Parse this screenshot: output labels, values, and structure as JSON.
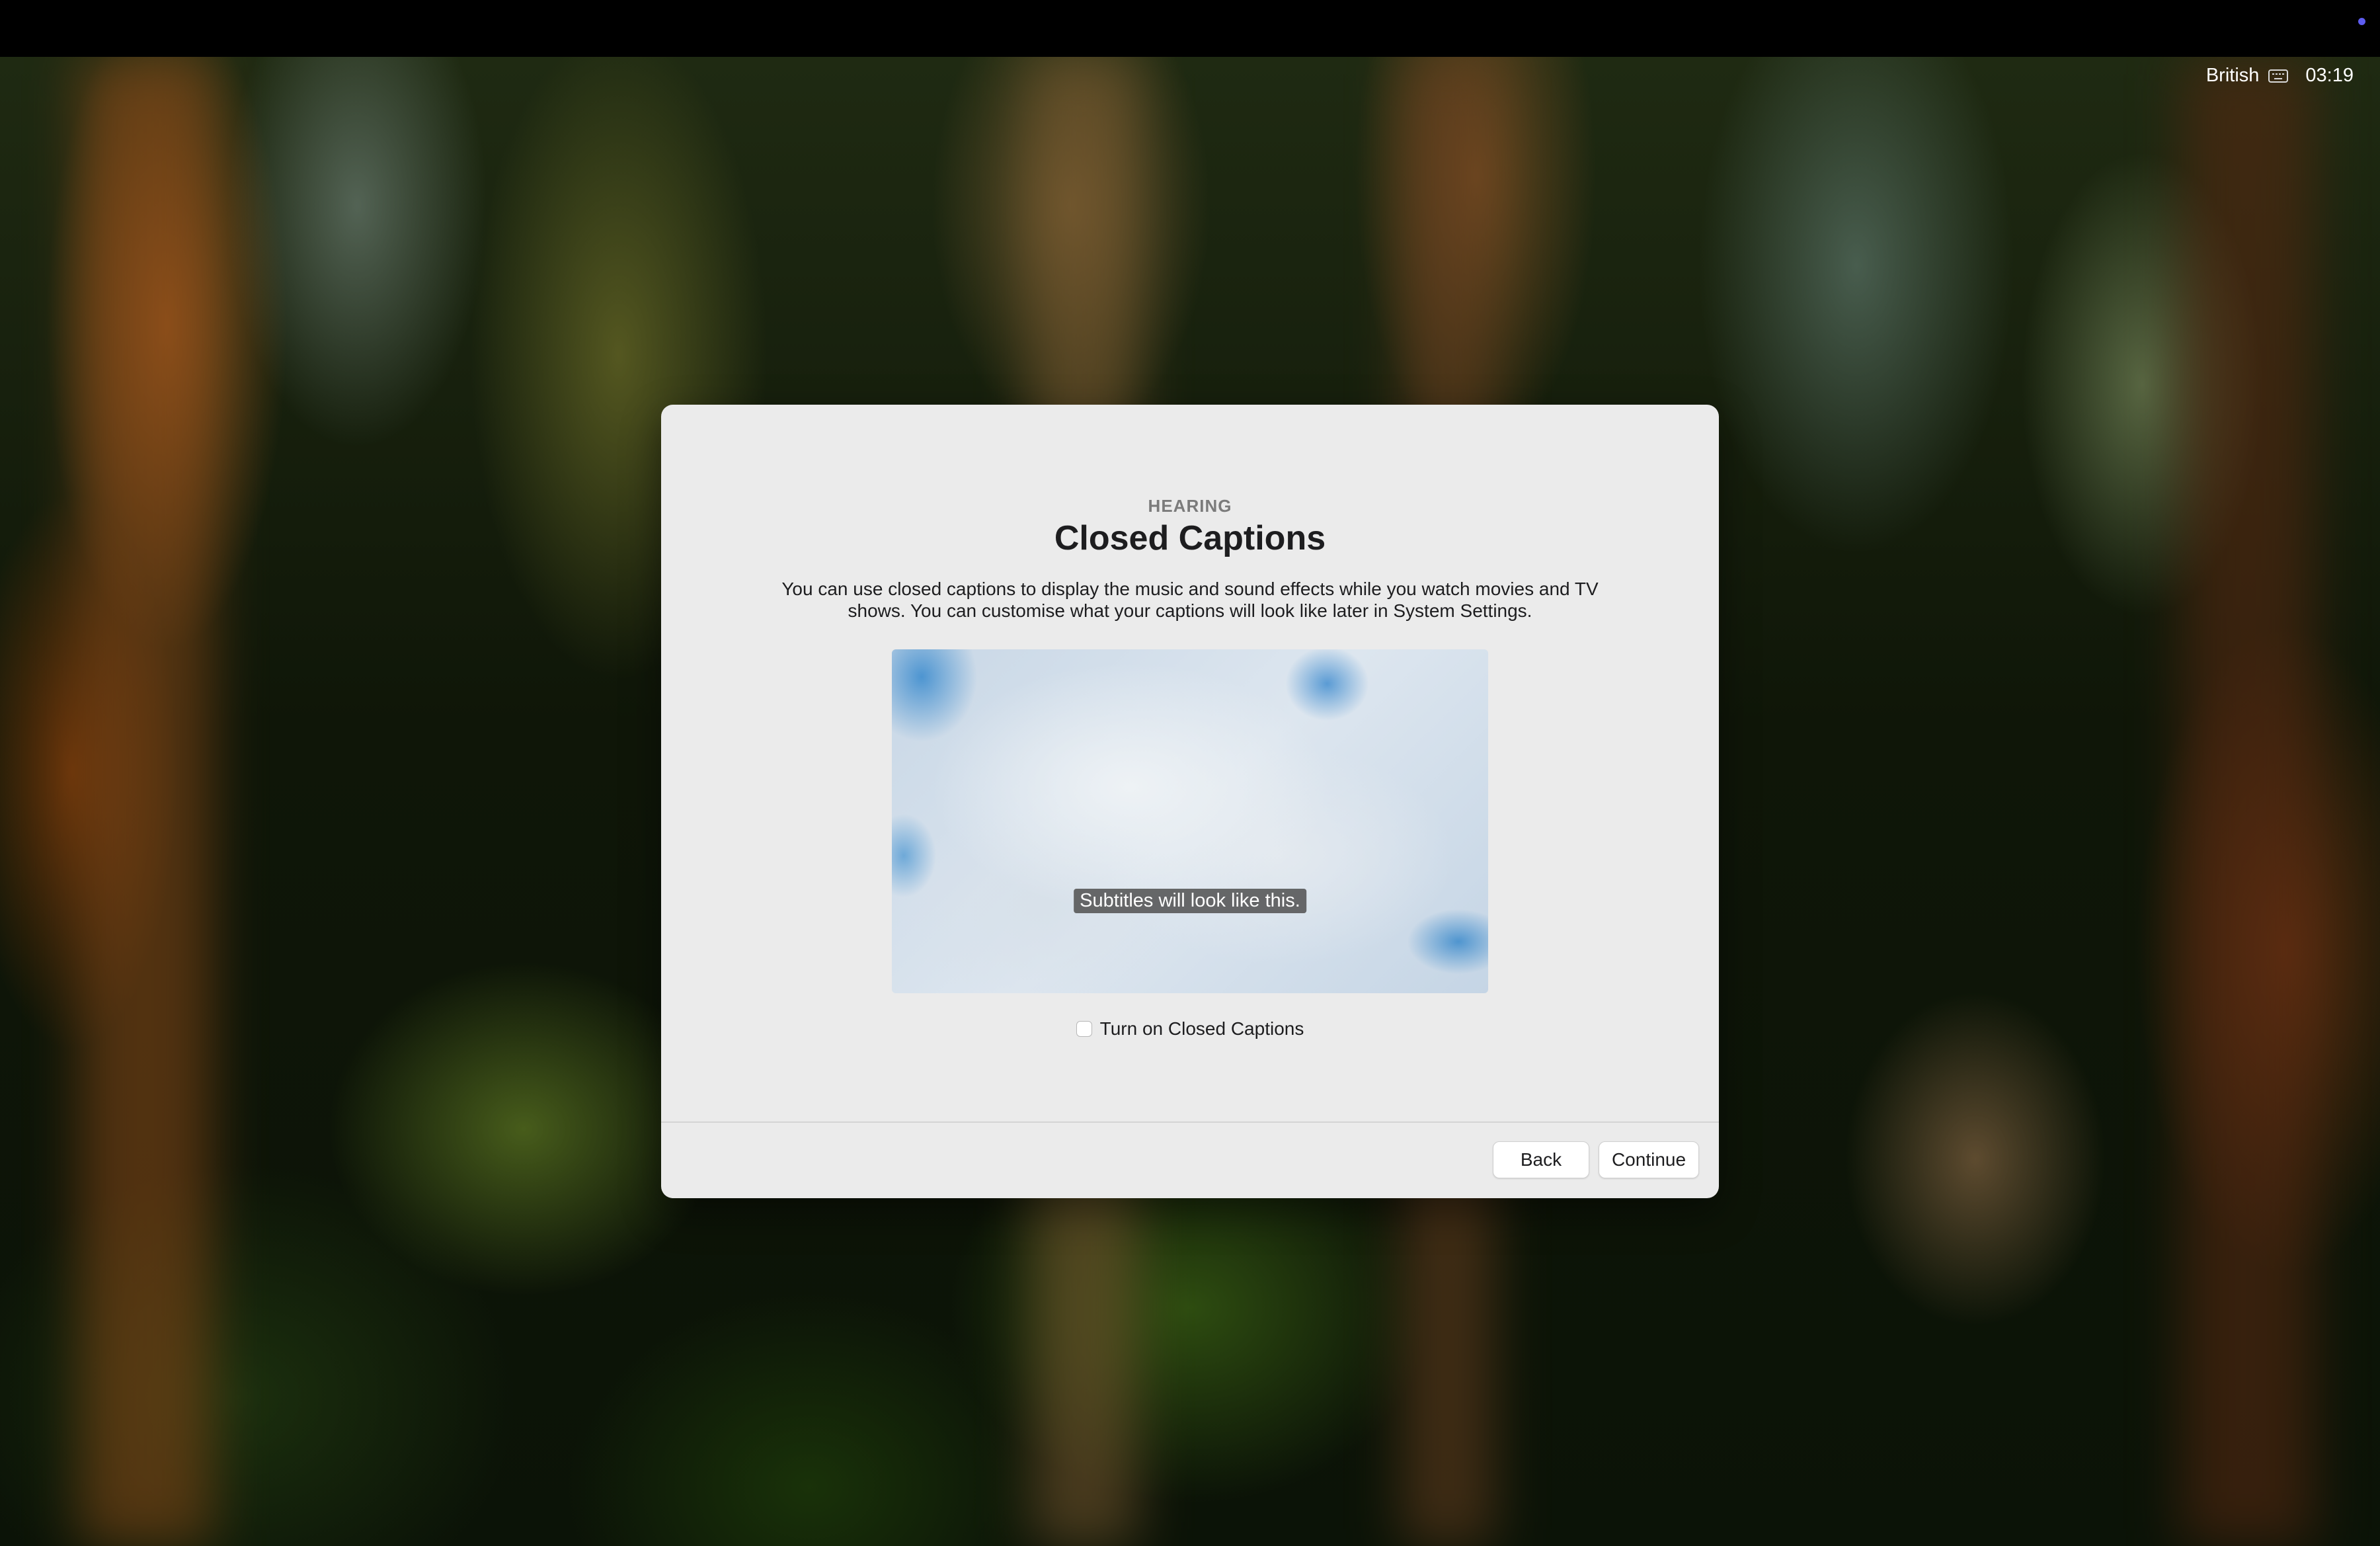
{
  "status_bar": {
    "input_source": "British",
    "input_source_icon": "keyboard-icon",
    "time": "03:19"
  },
  "dialog": {
    "section": "HEARING",
    "title": "Closed Captions",
    "description": "You can use closed captions to display the music and sound effects while you watch movies and TV shows. You can customise what your captions will look like later in System Settings.",
    "preview": {
      "subtitle_sample": "Subtitles will look like this."
    },
    "checkbox": {
      "label": "Turn on Closed Captions",
      "checked": false
    },
    "buttons": {
      "back": "Back",
      "continue": "Continue"
    }
  },
  "colors": {
    "dialog_background": "#ebebeb",
    "accent_dot": "#5d5cf0"
  }
}
